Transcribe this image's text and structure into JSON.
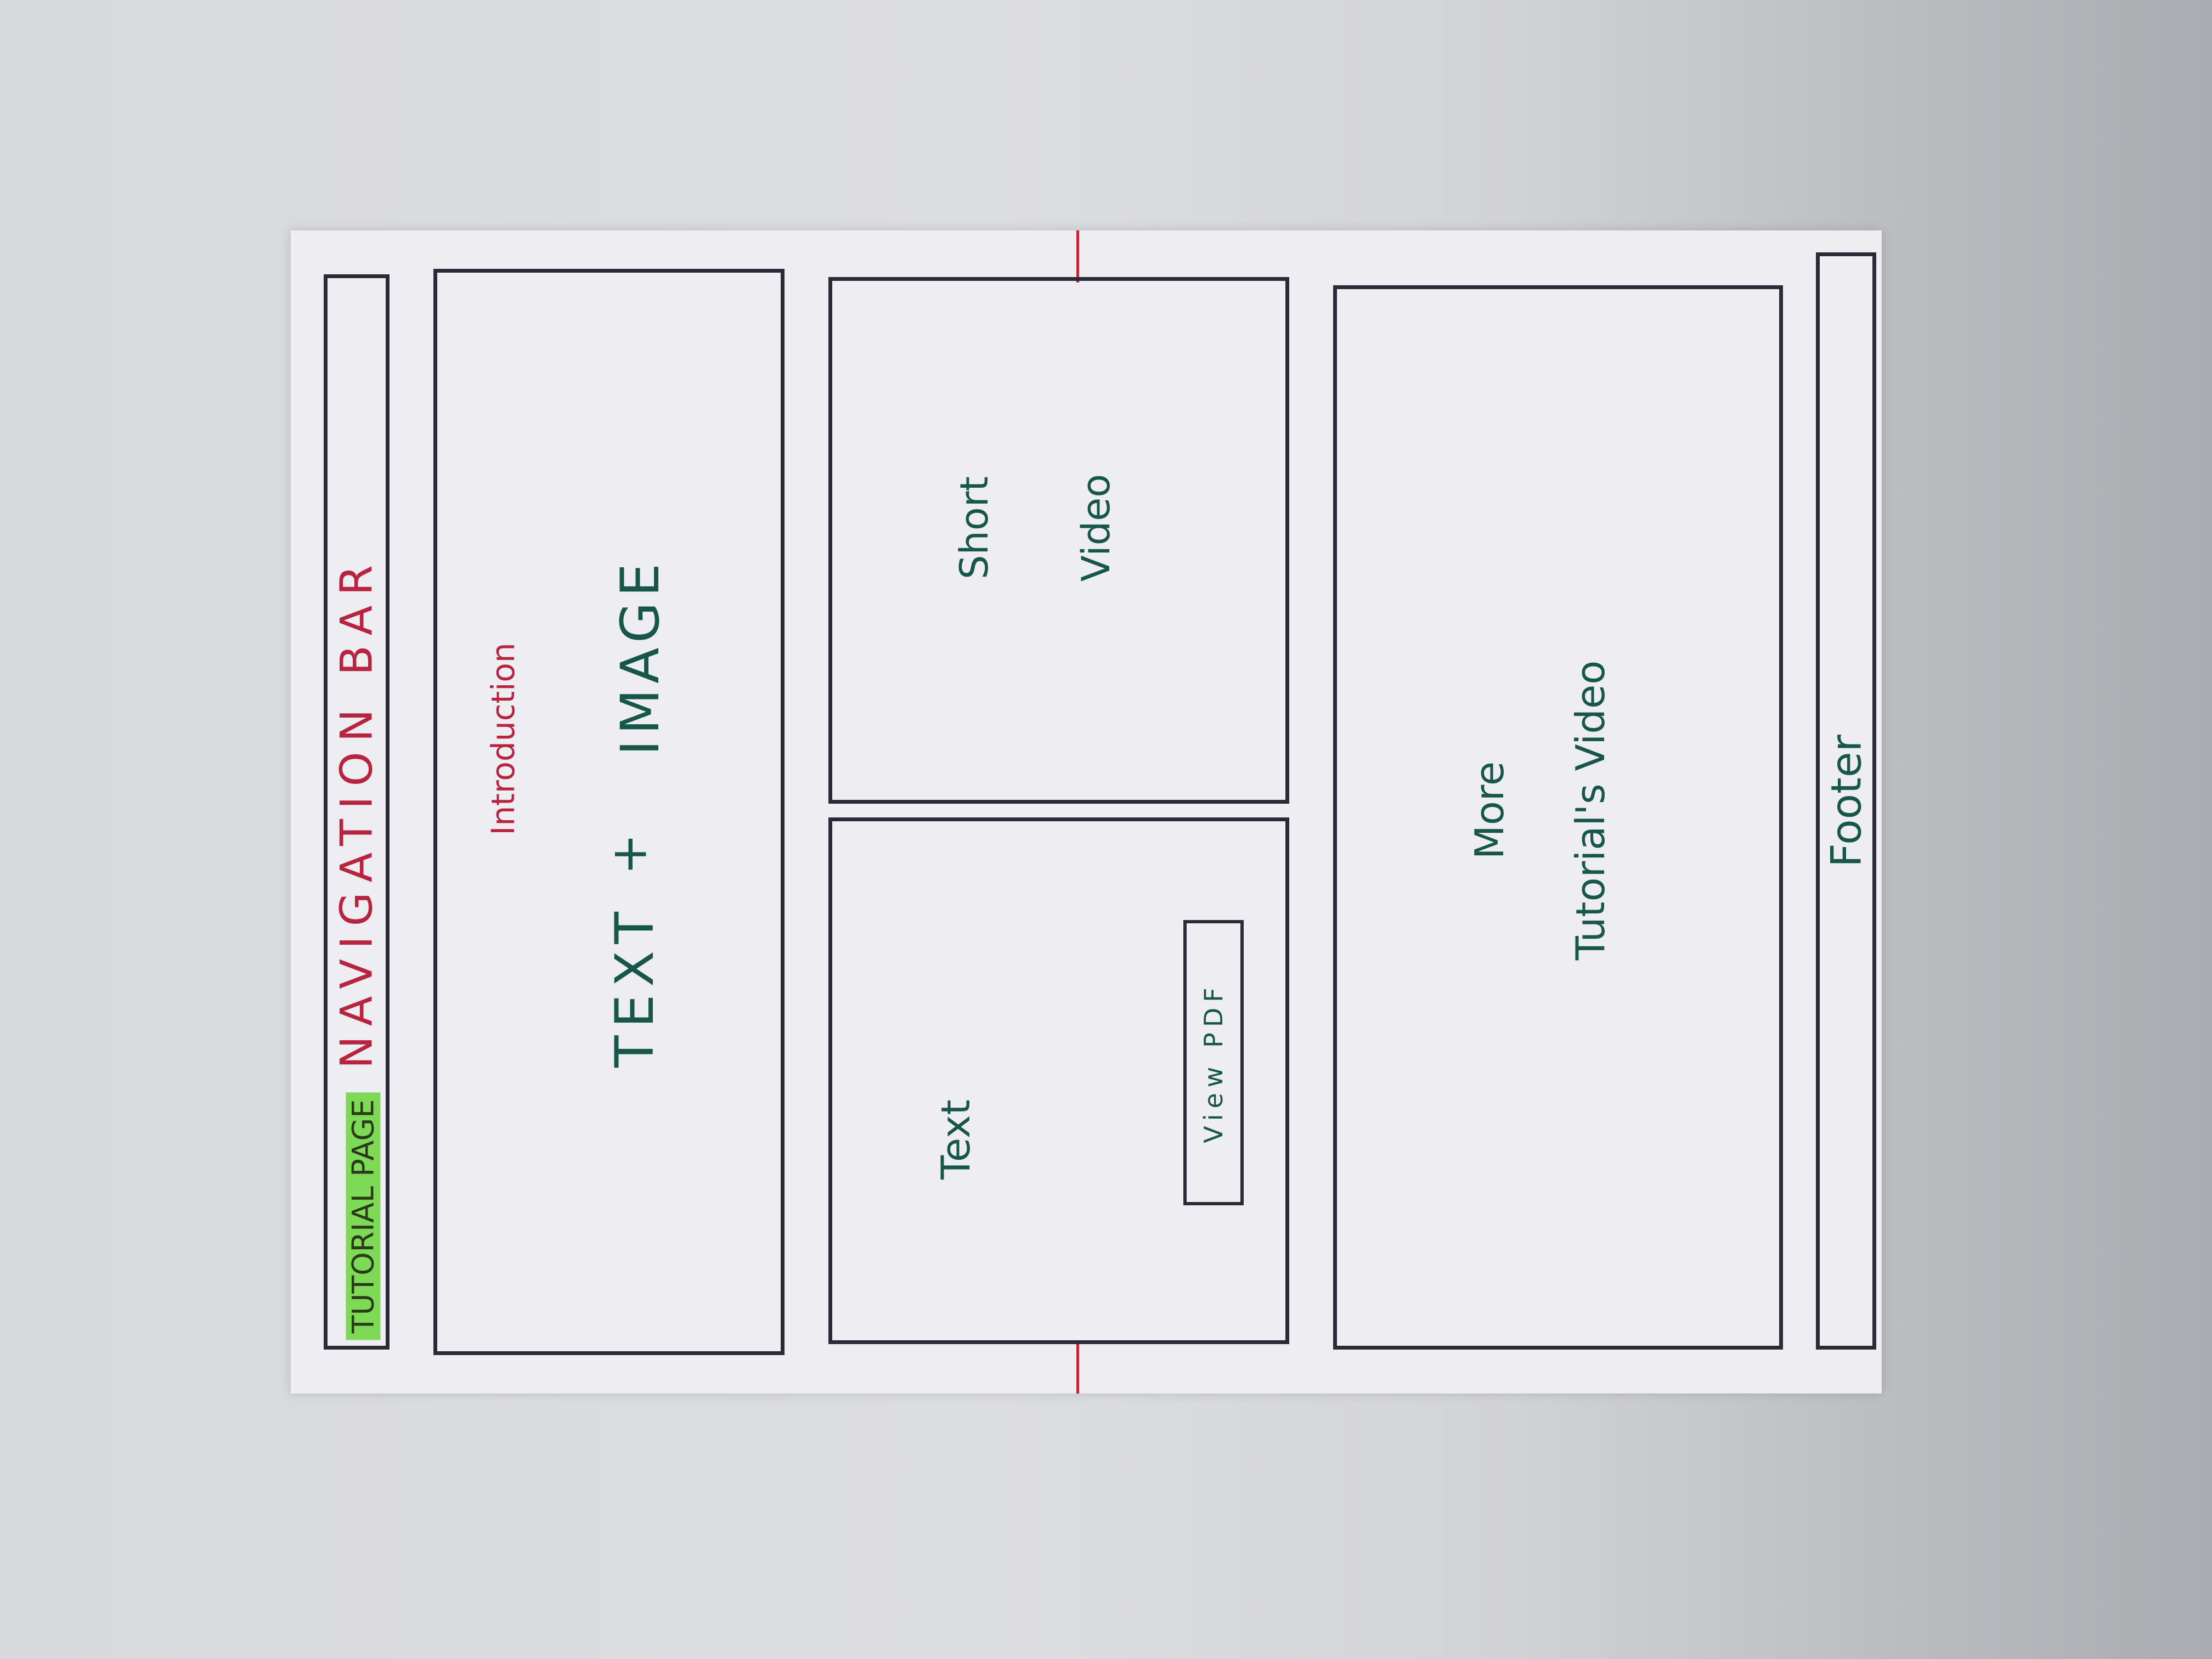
{
  "navigation": {
    "brand": "TUTORIAL PAGE",
    "title": "NAVIGATION BAR"
  },
  "intro": {
    "heading": "Introduction",
    "text": "TEXT",
    "plus": "+",
    "image": "IMAGE"
  },
  "short_video": {
    "line1": "Short",
    "line2": "Video"
  },
  "text_section": {
    "label": "Text",
    "button": "View PDF"
  },
  "more_tutorials": {
    "line1": "More",
    "line2": "Tutorial's Video"
  },
  "footer": {
    "label": "Footer"
  },
  "colors": {
    "ink": "#2b2b38",
    "red_marker": "#b8233f",
    "green_marker": "#17574a",
    "highlight": "#7ed957"
  }
}
